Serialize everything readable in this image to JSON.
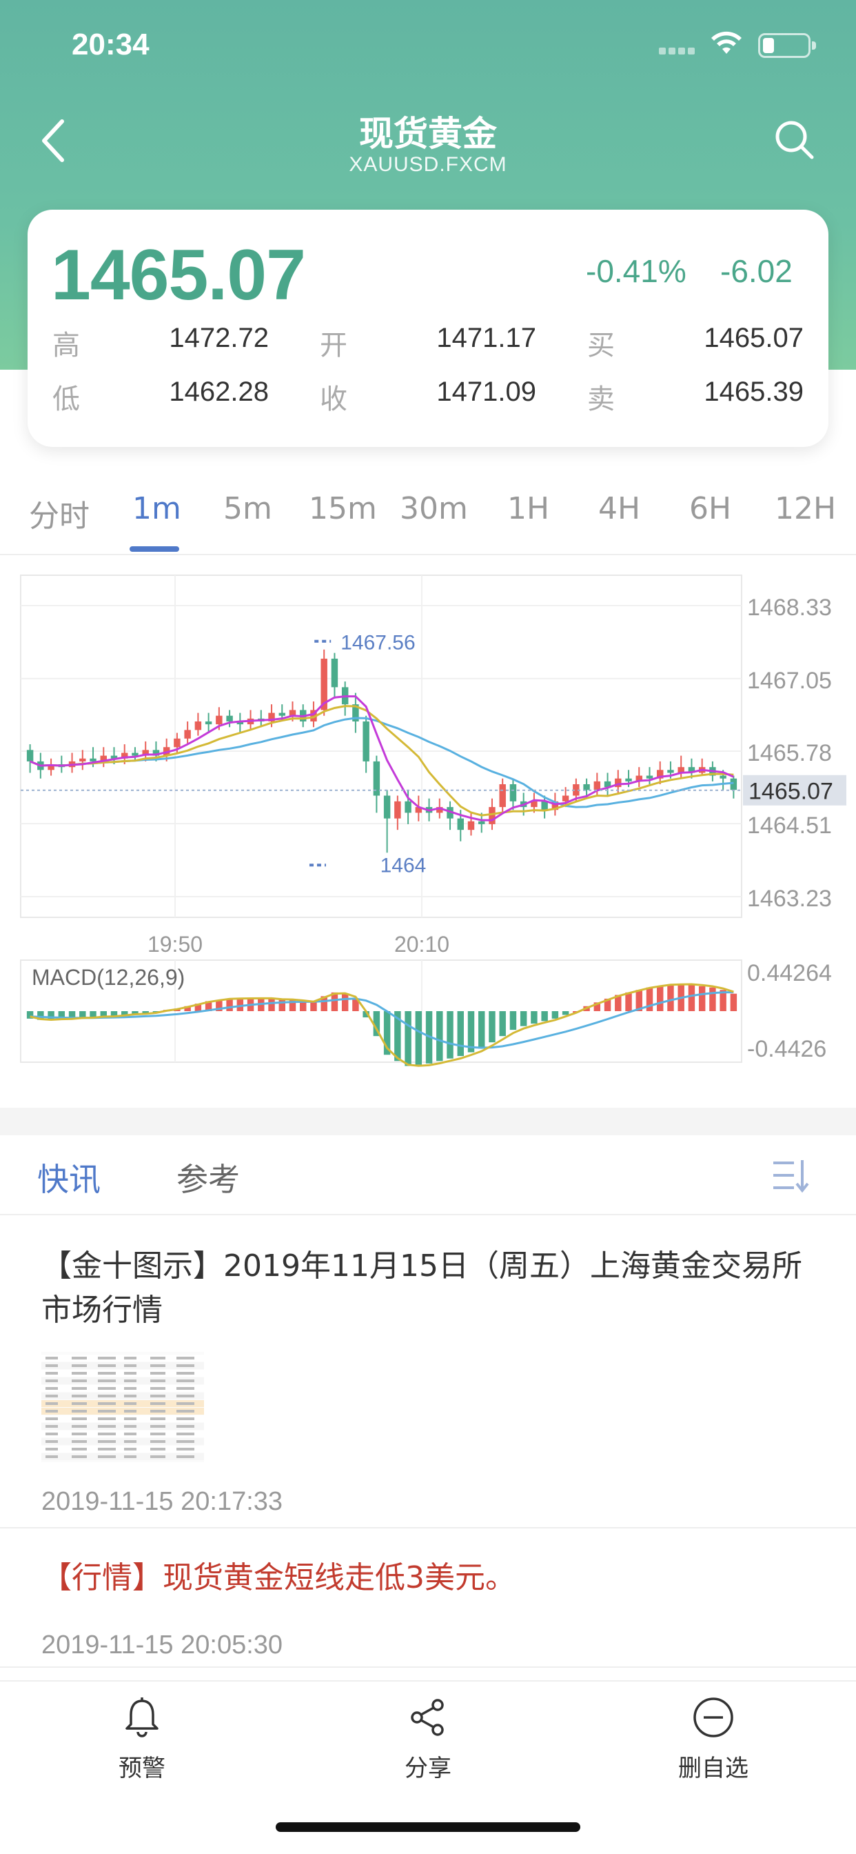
{
  "status_bar": {
    "time": "20:34"
  },
  "nav": {
    "title": "现货黄金",
    "subtitle": "XAUUSD.FXCM"
  },
  "quote": {
    "price": "1465.07",
    "change_pct": "-0.41%",
    "change_abs": "-6.02",
    "high_label": "高",
    "high": "1472.72",
    "open_label": "开",
    "open": "1471.17",
    "bid_label": "买",
    "bid": "1465.07",
    "low_label": "低",
    "low": "1462.28",
    "close_label": "收",
    "close": "1471.09",
    "ask_label": "卖",
    "ask": "1465.39",
    "accent_color": "#4aa68a"
  },
  "periods": {
    "tabs": [
      "分时",
      "1m",
      "5m",
      "15m",
      "30m",
      "1H",
      "4H",
      "6H",
      "12H"
    ],
    "active": "1m"
  },
  "chart_data": [
    {
      "type": "candlestick",
      "y_ticks": [
        "1468.33",
        "1467.05",
        "1465.78",
        "1464.51",
        "1463.23"
      ],
      "x_ticks": [
        "19:50",
        "20:10"
      ],
      "current_price_label": "1465.07",
      "max_label": "1467.56",
      "min_label": "1464",
      "ylim": [
        1463.23,
        1468.33
      ],
      "candles": [
        [
          1465.8,
          1465.6,
          1465.9,
          1465.4
        ],
        [
          1465.6,
          1465.45,
          1465.75,
          1465.3
        ],
        [
          1465.45,
          1465.55,
          1465.65,
          1465.35
        ],
        [
          1465.55,
          1465.5,
          1465.7,
          1465.4
        ],
        [
          1465.5,
          1465.6,
          1465.75,
          1465.4
        ],
        [
          1465.6,
          1465.65,
          1465.8,
          1465.45
        ],
        [
          1465.65,
          1465.6,
          1465.85,
          1465.5
        ],
        [
          1465.6,
          1465.7,
          1465.85,
          1465.5
        ],
        [
          1465.7,
          1465.65,
          1465.85,
          1465.55
        ],
        [
          1465.65,
          1465.75,
          1465.9,
          1465.55
        ],
        [
          1465.75,
          1465.7,
          1465.85,
          1465.6
        ],
        [
          1465.7,
          1465.8,
          1465.95,
          1465.6
        ],
        [
          1465.8,
          1465.7,
          1465.95,
          1465.6
        ],
        [
          1465.7,
          1465.85,
          1466.0,
          1465.6
        ],
        [
          1465.85,
          1466.0,
          1466.1,
          1465.75
        ],
        [
          1466.0,
          1466.15,
          1466.3,
          1465.9
        ],
        [
          1466.15,
          1466.3,
          1466.45,
          1466.05
        ],
        [
          1466.3,
          1466.25,
          1466.45,
          1466.1
        ],
        [
          1466.25,
          1466.4,
          1466.55,
          1466.15
        ],
        [
          1466.4,
          1466.3,
          1466.5,
          1466.2
        ],
        [
          1466.3,
          1466.25,
          1466.45,
          1466.1
        ],
        [
          1466.25,
          1466.35,
          1466.5,
          1466.15
        ],
        [
          1466.35,
          1466.3,
          1466.5,
          1466.2
        ],
        [
          1466.3,
          1466.45,
          1466.6,
          1466.2
        ],
        [
          1466.45,
          1466.4,
          1466.6,
          1466.3
        ],
        [
          1466.4,
          1466.5,
          1466.65,
          1466.3
        ],
        [
          1466.5,
          1466.3,
          1466.6,
          1466.2
        ],
        [
          1466.3,
          1466.5,
          1466.65,
          1466.2
        ],
        [
          1466.5,
          1467.4,
          1467.56,
          1466.4
        ],
        [
          1467.4,
          1466.9,
          1467.5,
          1466.7
        ],
        [
          1466.9,
          1466.6,
          1467.0,
          1466.4
        ],
        [
          1466.6,
          1466.3,
          1466.8,
          1466.1
        ],
        [
          1466.3,
          1465.6,
          1466.4,
          1465.4
        ],
        [
          1465.6,
          1465.0,
          1465.7,
          1464.7
        ],
        [
          1465.0,
          1464.6,
          1465.1,
          1464.0
        ],
        [
          1464.6,
          1464.9,
          1465.0,
          1464.4
        ],
        [
          1464.9,
          1464.7,
          1465.1,
          1464.5
        ],
        [
          1464.7,
          1464.8,
          1465.0,
          1464.55
        ],
        [
          1464.8,
          1464.7,
          1464.95,
          1464.55
        ],
        [
          1464.7,
          1464.8,
          1464.95,
          1464.6
        ],
        [
          1464.8,
          1464.6,
          1464.9,
          1464.4
        ],
        [
          1464.6,
          1464.4,
          1464.75,
          1464.2
        ],
        [
          1464.4,
          1464.55,
          1464.7,
          1464.3
        ],
        [
          1464.55,
          1464.5,
          1464.7,
          1464.35
        ],
        [
          1464.5,
          1464.8,
          1464.95,
          1464.4
        ],
        [
          1464.8,
          1465.2,
          1465.3,
          1464.7
        ],
        [
          1465.2,
          1464.9,
          1465.3,
          1464.75
        ],
        [
          1464.9,
          1464.8,
          1465.05,
          1464.65
        ],
        [
          1464.8,
          1464.9,
          1465.05,
          1464.7
        ],
        [
          1464.9,
          1464.75,
          1465.0,
          1464.6
        ],
        [
          1464.75,
          1464.9,
          1465.05,
          1464.65
        ],
        [
          1464.9,
          1465.0,
          1465.15,
          1464.8
        ],
        [
          1465.0,
          1465.2,
          1465.3,
          1464.9
        ],
        [
          1465.2,
          1465.1,
          1465.3,
          1464.95
        ],
        [
          1465.1,
          1465.25,
          1465.4,
          1465.0
        ],
        [
          1465.25,
          1465.15,
          1465.4,
          1465.0
        ],
        [
          1465.15,
          1465.3,
          1465.45,
          1465.05
        ],
        [
          1465.3,
          1465.25,
          1465.45,
          1465.15
        ],
        [
          1465.25,
          1465.35,
          1465.5,
          1465.15
        ],
        [
          1465.35,
          1465.3,
          1465.5,
          1465.2
        ],
        [
          1465.3,
          1465.45,
          1465.6,
          1465.2
        ],
        [
          1465.45,
          1465.4,
          1465.6,
          1465.3
        ],
        [
          1465.4,
          1465.5,
          1465.7,
          1465.3
        ],
        [
          1465.5,
          1465.4,
          1465.65,
          1465.3
        ],
        [
          1465.4,
          1465.5,
          1465.65,
          1465.35
        ],
        [
          1465.5,
          1465.35,
          1465.6,
          1465.25
        ],
        [
          1465.35,
          1465.3,
          1465.45,
          1465.1
        ],
        [
          1465.3,
          1465.1,
          1465.35,
          1464.95
        ]
      ],
      "candle_fields": [
        "open",
        "close",
        "high",
        "low"
      ],
      "series_colors": {
        "up": "#e95f58",
        "down": "#4aab8b",
        "ma5": "#c43bd9",
        "ma10": "#d4b936",
        "ma20": "#59b1e0"
      }
    },
    {
      "type": "bar",
      "title": "MACD(12,26,9)",
      "y_ticks": [
        "0.44264",
        "-0.4426"
      ],
      "ylim": [
        -0.4426,
        0.44264
      ],
      "values": [
        -0.06,
        -0.07,
        -0.07,
        -0.06,
        -0.06,
        -0.05,
        -0.05,
        -0.04,
        -0.04,
        -0.03,
        -0.02,
        -0.02,
        -0.01,
        0.01,
        0.02,
        0.04,
        0.06,
        0.08,
        0.09,
        0.1,
        0.1,
        0.1,
        0.1,
        0.1,
        0.09,
        0.09,
        0.08,
        0.07,
        0.12,
        0.15,
        0.14,
        0.1,
        -0.05,
        -0.2,
        -0.35,
        -0.4,
        -0.44,
        -0.43,
        -0.42,
        -0.4,
        -0.38,
        -0.36,
        -0.33,
        -0.3,
        -0.25,
        -0.2,
        -0.15,
        -0.12,
        -0.1,
        -0.08,
        -0.06,
        -0.03,
        0.0,
        0.04,
        0.07,
        0.1,
        0.13,
        0.15,
        0.17,
        0.19,
        0.2,
        0.21,
        0.21,
        0.21,
        0.2,
        0.19,
        0.17,
        0.14
      ],
      "colors": {
        "positive": "#e95f58",
        "negative": "#4aab8b",
        "dif": "#d4b936",
        "dea": "#59b1e0"
      }
    }
  ],
  "news_tabs": {
    "tabs": [
      "快讯",
      "参考"
    ],
    "active": "快讯"
  },
  "news": [
    {
      "title": "【金十图示】2019年11月15日（周五）上海黄金交易所市场行情",
      "time": "2019-11-15 20:17:33",
      "has_image": true
    },
    {
      "title": "【行情】现货黄金短线走低3美元。",
      "time": "2019-11-15 20:05:30",
      "highlight": true
    }
  ],
  "bottom_bar": {
    "items": [
      {
        "label": "预警",
        "icon": "bell-icon"
      },
      {
        "label": "分享",
        "icon": "share-icon"
      },
      {
        "label": "删自选",
        "icon": "minus-circle-icon"
      }
    ]
  }
}
